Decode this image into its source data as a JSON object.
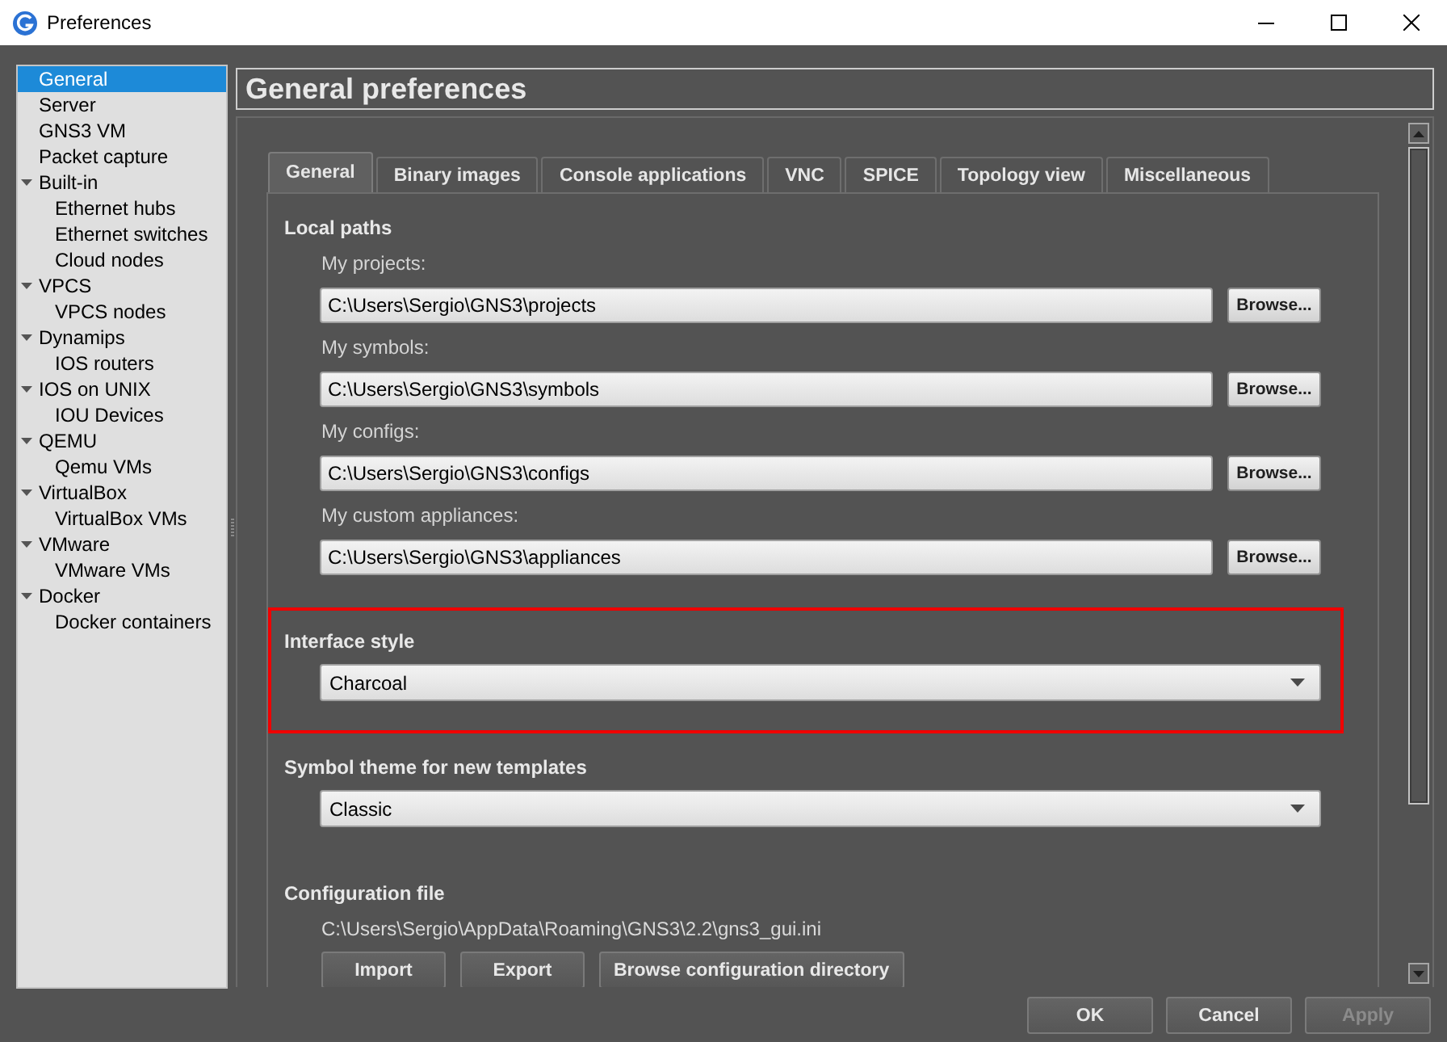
{
  "window": {
    "title": "Preferences"
  },
  "sidebar": {
    "items": [
      {
        "label": "General",
        "selected": true
      },
      {
        "label": "Server",
        "selected": false
      },
      {
        "label": "GNS3 VM",
        "selected": false
      },
      {
        "label": "Packet capture",
        "selected": false
      },
      {
        "label": "Built-in",
        "selected": false,
        "expanded": true,
        "children": [
          {
            "label": "Ethernet hubs",
            "selected": false
          },
          {
            "label": "Ethernet switches",
            "selected": false
          },
          {
            "label": "Cloud nodes",
            "selected": false
          }
        ]
      },
      {
        "label": "VPCS",
        "selected": false,
        "expanded": true,
        "children": [
          {
            "label": "VPCS nodes",
            "selected": false
          }
        ]
      },
      {
        "label": "Dynamips",
        "selected": false,
        "expanded": true,
        "children": [
          {
            "label": "IOS routers",
            "selected": false
          }
        ]
      },
      {
        "label": "IOS on UNIX",
        "selected": false,
        "expanded": true,
        "children": [
          {
            "label": "IOU Devices",
            "selected": false
          }
        ]
      },
      {
        "label": "QEMU",
        "selected": false,
        "expanded": true,
        "children": [
          {
            "label": "Qemu VMs",
            "selected": false
          }
        ]
      },
      {
        "label": "VirtualBox",
        "selected": false,
        "expanded": true,
        "children": [
          {
            "label": "VirtualBox VMs",
            "selected": false
          }
        ]
      },
      {
        "label": "VMware",
        "selected": false,
        "expanded": true,
        "children": [
          {
            "label": "VMware VMs",
            "selected": false
          }
        ]
      },
      {
        "label": "Docker",
        "selected": false,
        "expanded": true,
        "children": [
          {
            "label": "Docker containers",
            "selected": false
          }
        ]
      }
    ]
  },
  "page_title": "General preferences",
  "tabs": [
    {
      "label": "General",
      "selected": true
    },
    {
      "label": "Binary images",
      "selected": false
    },
    {
      "label": "Console applications",
      "selected": false
    },
    {
      "label": "VNC",
      "selected": false
    },
    {
      "label": "SPICE",
      "selected": false
    },
    {
      "label": "Topology view",
      "selected": false
    },
    {
      "label": "Miscellaneous",
      "selected": false
    }
  ],
  "sections": [
    {
      "kind": "paths",
      "title": "Local paths",
      "highlighted": false,
      "fields": [
        {
          "label": "My projects:",
          "value": "C:\\Users\\Sergio\\GNS3\\projects",
          "button": "Browse..."
        },
        {
          "label": "My symbols:",
          "value": "C:\\Users\\Sergio\\GNS3\\symbols",
          "button": "Browse..."
        },
        {
          "label": "My configs:",
          "value": "C:\\Users\\Sergio\\GNS3\\configs",
          "button": "Browse..."
        },
        {
          "label": "My custom appliances:",
          "value": "C:\\Users\\Sergio\\GNS3\\appliances",
          "button": "Browse..."
        }
      ]
    },
    {
      "kind": "select",
      "title": "Interface style",
      "highlighted": true,
      "value": "Charcoal"
    },
    {
      "kind": "select",
      "title": "Symbol theme for new templates",
      "highlighted": false,
      "value": "Classic"
    },
    {
      "kind": "file",
      "title": "Configuration file",
      "highlighted": false,
      "path": "C:\\Users\\Sergio\\AppData\\Roaming\\GNS3\\2.2\\gns3_gui.ini",
      "buttons": [
        "Import",
        "Export",
        "Browse configuration directory"
      ]
    }
  ],
  "footer_buttons": [
    {
      "label": "OK",
      "disabled": false
    },
    {
      "label": "Cancel",
      "disabled": false
    },
    {
      "label": "Apply",
      "disabled": true
    }
  ]
}
